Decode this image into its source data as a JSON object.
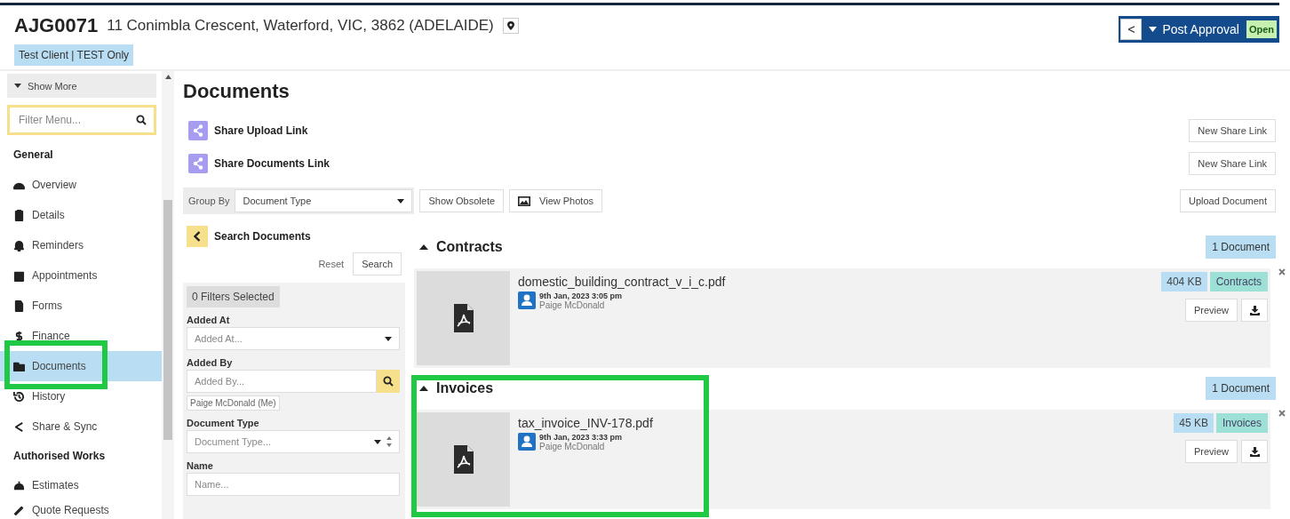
{
  "header": {
    "job_code": "AJG0071",
    "address": "11 Conimbla Crescent, Waterford, VIC, 3862 (ADELAIDE)",
    "client_tag": "Test Client | TEST Only",
    "stage": {
      "back": "<",
      "label": "Post Approval",
      "status": "Open"
    }
  },
  "sidebar": {
    "show_more": "Show More",
    "filter": {
      "placeholder": "Filter Menu..."
    },
    "sections": [
      {
        "title": "General",
        "items": [
          {
            "label": "Overview",
            "selected": false
          },
          {
            "label": "Details",
            "selected": false
          },
          {
            "label": "Reminders",
            "selected": false
          },
          {
            "label": "Appointments",
            "selected": false
          },
          {
            "label": "Forms",
            "selected": false
          },
          {
            "label": "Finance",
            "selected": false
          },
          {
            "label": "Documents",
            "selected": true
          },
          {
            "label": "History",
            "selected": false
          },
          {
            "label": "Share & Sync",
            "selected": false
          }
        ]
      },
      {
        "title": "Authorised Works",
        "items": [
          {
            "label": "Estimates",
            "selected": false
          },
          {
            "label": "Quote Requests",
            "selected": false
          }
        ]
      }
    ]
  },
  "page": {
    "title": "Documents",
    "share_links": [
      {
        "label": "Share Upload Link",
        "button": "New Share Link"
      },
      {
        "label": "Share Documents Link",
        "button": "New Share Link"
      }
    ],
    "toolbar": {
      "group_by_label": "Group By",
      "group_by_value": "Document Type",
      "show_obsolete": "Show Obsolete",
      "view_photos": "View Photos",
      "upload": "Upload Document"
    }
  },
  "search_panel": {
    "title": "Search Documents",
    "reset": "Reset",
    "search": "Search",
    "filters_selected": "0 Filters Selected",
    "fields": [
      {
        "label": "Added At",
        "placeholder": "Added At...",
        "kind": "select"
      },
      {
        "label": "Added By",
        "placeholder": "Added By...",
        "kind": "search",
        "chip": "Paige McDonald (Me)"
      },
      {
        "label": "Document Type",
        "placeholder": "Document Type...",
        "kind": "spinselect"
      },
      {
        "label": "Name",
        "placeholder": "Name...",
        "kind": "text"
      }
    ]
  },
  "groups": [
    {
      "name": "Contracts",
      "expanded": true,
      "count": "1 Document",
      "files": [
        {
          "name": "domestic_building_contract_v_i_c.pdf",
          "date": "9th Jan, 2023 3:05 pm",
          "user": "Paige McDonald",
          "size": "404 KB",
          "type": "Contracts",
          "preview": "Preview"
        }
      ]
    },
    {
      "name": "Invoices",
      "expanded": true,
      "count": "1 Document",
      "files": [
        {
          "name": "tax_invoice_INV-178.pdf",
          "date": "9th Jan, 2023 3:33 pm",
          "user": "Paige McDonald",
          "size": "45 KB",
          "type": "Invoices",
          "preview": "Preview"
        }
      ]
    }
  ]
}
